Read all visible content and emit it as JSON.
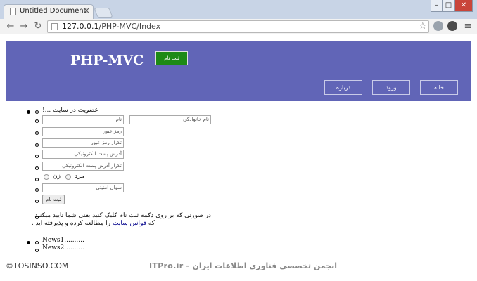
{
  "browser": {
    "tab_title": "Untitled Document",
    "tab_close": "×",
    "window_controls": [
      "–",
      "□",
      "✕"
    ],
    "url_host": "127.0.0.1",
    "url_path": "/PHP-MVC/Index",
    "icons": [
      "back-icon",
      "forward-icon",
      "reload-icon",
      "page-icon",
      "star-icon",
      "menu-icon"
    ]
  },
  "header": {
    "logo": "PHP-MVC",
    "signup_button": "ثبت نام",
    "nav": [
      {
        "label": "خانه"
      },
      {
        "label": "ورود"
      },
      {
        "label": "درباره"
      }
    ],
    "bg_color": "#6165b7"
  },
  "form": {
    "heading": "!... عضویت در سایت",
    "first_name": "نام",
    "last_name": "نام خانوادگی",
    "password": "رمز عبور",
    "password_repeat": "تکرار رمز عبور",
    "email": "آدرس پست الکترونیکی",
    "email_repeat": "تکرار آدرس پست الکترونیکی",
    "gender_male": "مرد",
    "gender_female": "زن",
    "security_question": "سوال امنیتی",
    "submit": "ثبت نام",
    "terms_line1": "در صورتی که بر روی دکمه ثبت نام کلیک کنید یعنی شما تایید میکنید",
    "terms_pre": "که ",
    "terms_link": "قوانین سایت",
    "terms_post": " را مطالعه کرده و پذیرفته اید ."
  },
  "news": [
    "News1..........",
    "News2.........."
  ],
  "watermarks": {
    "left": "©TOSINSO.COM",
    "right": "ITPro.ir - انجمن تخصصی فناوری اطلاعات ایران"
  }
}
